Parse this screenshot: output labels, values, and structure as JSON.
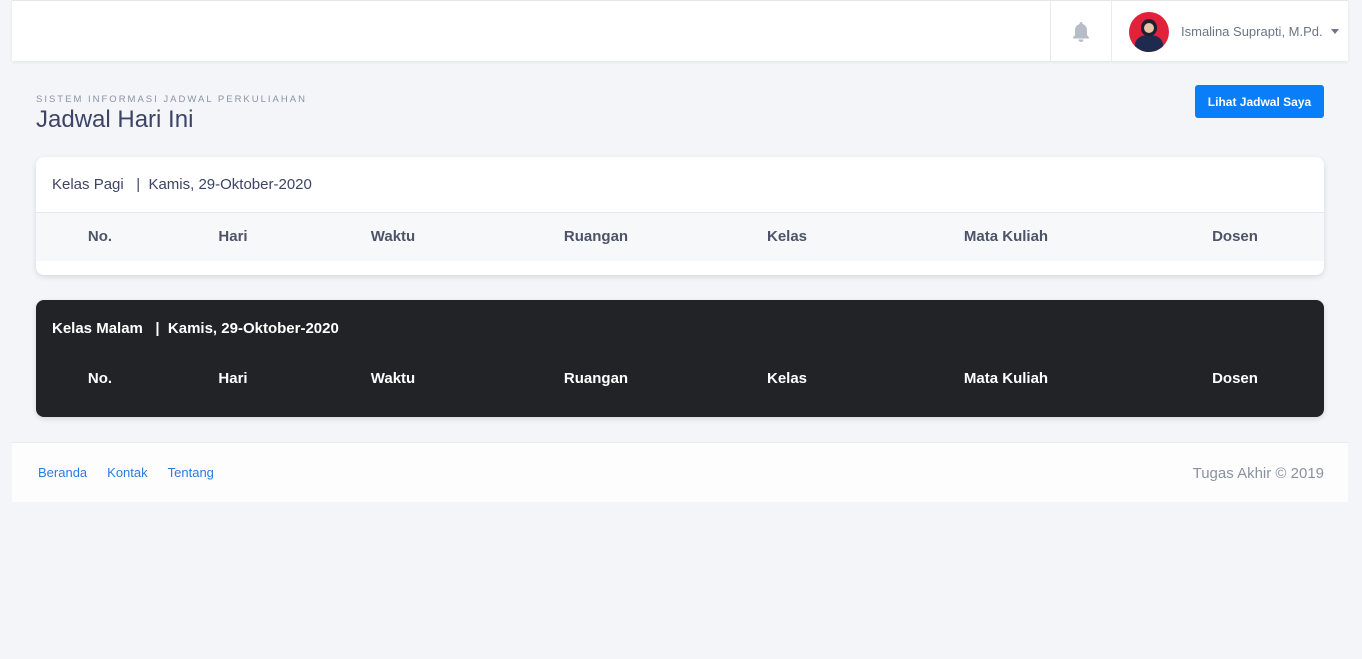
{
  "topbar": {
    "notification_icon": "bell-icon",
    "user_name": "Ismalina Suprapti, M.Pd.",
    "caret_icon": "caret-down-icon"
  },
  "page": {
    "subtitle": "SISTEM INFORMASI JADWAL PERKULIAHAN",
    "title": "Jadwal Hari Ini",
    "action_button": "Lihat Jadwal Saya"
  },
  "morning_card": {
    "header": "Kelas Pagi   |  Kamis, 29-Oktober-2020",
    "columns": [
      "No.",
      "Hari",
      "Waktu",
      "Ruangan",
      "Kelas",
      "Mata Kuliah",
      "Dosen"
    ],
    "rows": []
  },
  "evening_card": {
    "header": "Kelas Malam   |  Kamis, 29-Oktober-2020",
    "columns": [
      "No.",
      "Hari",
      "Waktu",
      "Ruangan",
      "Kelas",
      "Mata Kuliah",
      "Dosen"
    ],
    "rows": []
  },
  "footer": {
    "links": [
      "Beranda",
      "Kontak",
      "Tentang"
    ],
    "copyright": "Tugas Akhir © 2019"
  },
  "colors": {
    "primary": "#0a7df8",
    "dark_card": "#212327",
    "background": "#f4f5f8"
  }
}
